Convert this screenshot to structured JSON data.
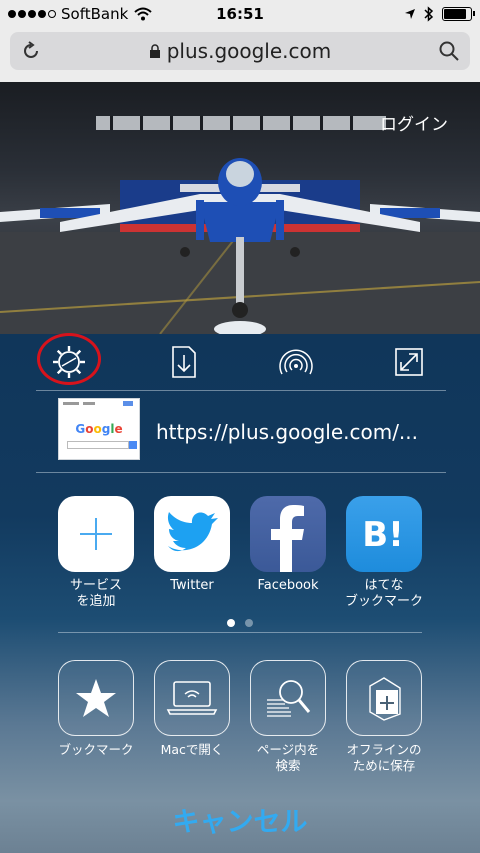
{
  "status_bar": {
    "signal_bars": 5,
    "signal_filled": 4,
    "carrier": "SoftBank",
    "time": "16:51",
    "battery_level": 0.85
  },
  "browser": {
    "url": "plus.google.com"
  },
  "page": {
    "login_label": "ログイン"
  },
  "share_sheet": {
    "top_icons": [
      "gear-icon",
      "download-icon",
      "airdrop-icon",
      "fullscreen-icon"
    ],
    "preview_url": "https://plus.google.com/...",
    "thumbnail_logo": "Google",
    "apps": [
      {
        "label": "サービス\nを追加",
        "icon": "plus-icon"
      },
      {
        "label": "Twitter",
        "icon": "twitter-icon"
      },
      {
        "label": "Facebook",
        "icon": "facebook-icon"
      },
      {
        "label": "はてな\nブックマーク",
        "icon": "hatena-bookmark-icon"
      }
    ],
    "page_dots": 2,
    "page_active": 0,
    "actions": [
      {
        "label": "ブックマーク",
        "icon": "star-icon"
      },
      {
        "label": "Macで開く",
        "icon": "handoff-mac-icon"
      },
      {
        "label": "ページ内を\n検索",
        "icon": "find-in-page-icon"
      },
      {
        "label": "オフラインの\nために保存",
        "icon": "save-offline-icon"
      }
    ],
    "cancel_label": "キャンセル"
  },
  "colors": {
    "cancel": "#33aaf0",
    "highlight_ring": "#d7131c",
    "twitter": "#1da1f2",
    "facebook": "#3b5998",
    "hatena": "#1e8cdc"
  }
}
